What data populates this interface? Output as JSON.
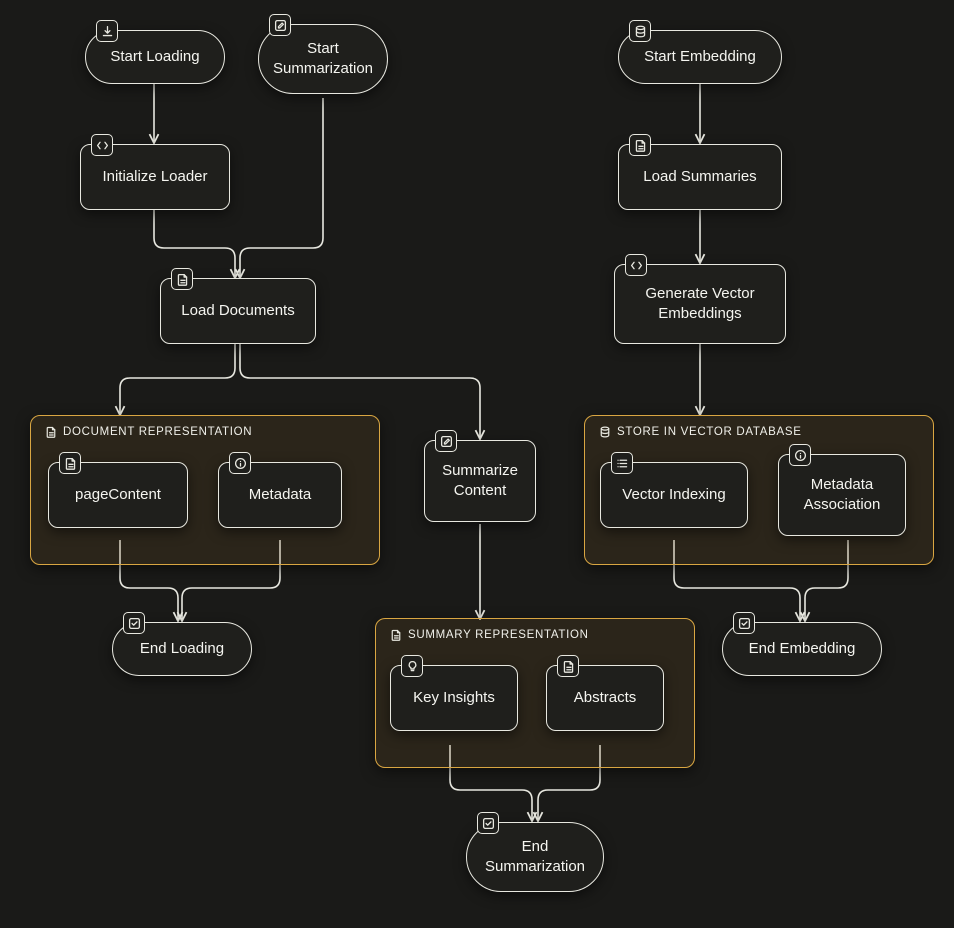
{
  "colors": {
    "bg": "#1a1a18",
    "node_border": "#e8e8e0",
    "group_border": "#d9a642",
    "group_fill": "rgba(120,90,40,0.18)"
  },
  "nodes": {
    "start_loading": {
      "label": "Start Loading",
      "icon": "download"
    },
    "initialize_loader": {
      "label": "Initialize Loader",
      "icon": "code"
    },
    "load_documents": {
      "label": "Load Documents",
      "icon": "document"
    },
    "page_content": {
      "label": "pageContent",
      "icon": "document"
    },
    "metadata": {
      "label": "Metadata",
      "icon": "info"
    },
    "end_loading": {
      "label": "End Loading",
      "icon": "check"
    },
    "start_summarization": {
      "label": "Start\nSummarization",
      "icon": "edit"
    },
    "summarize_content": {
      "label": "Summarize\nContent",
      "icon": "edit"
    },
    "key_insights": {
      "label": "Key Insights",
      "icon": "bulb"
    },
    "abstracts": {
      "label": "Abstracts",
      "icon": "document"
    },
    "end_summarization": {
      "label": "End\nSummarization",
      "icon": "check"
    },
    "start_embedding": {
      "label": "Start Embedding",
      "icon": "database"
    },
    "load_summaries": {
      "label": "Load Summaries",
      "icon": "document"
    },
    "generate_embeddings": {
      "label": "Generate Vector\nEmbeddings",
      "icon": "code"
    },
    "vector_indexing": {
      "label": "Vector Indexing",
      "icon": "list"
    },
    "metadata_assoc": {
      "label": "Metadata\nAssociation",
      "icon": "info"
    },
    "end_embedding": {
      "label": "End Embedding",
      "icon": "check"
    }
  },
  "groups": {
    "doc_rep": {
      "label": "DOCUMENT REPRESENTATION",
      "icon": "document"
    },
    "summary_rep": {
      "label": "SUMMARY REPRESENTATION",
      "icon": "document"
    },
    "store_vec": {
      "label": "STORE IN VECTOR DATABASE",
      "icon": "database"
    }
  }
}
